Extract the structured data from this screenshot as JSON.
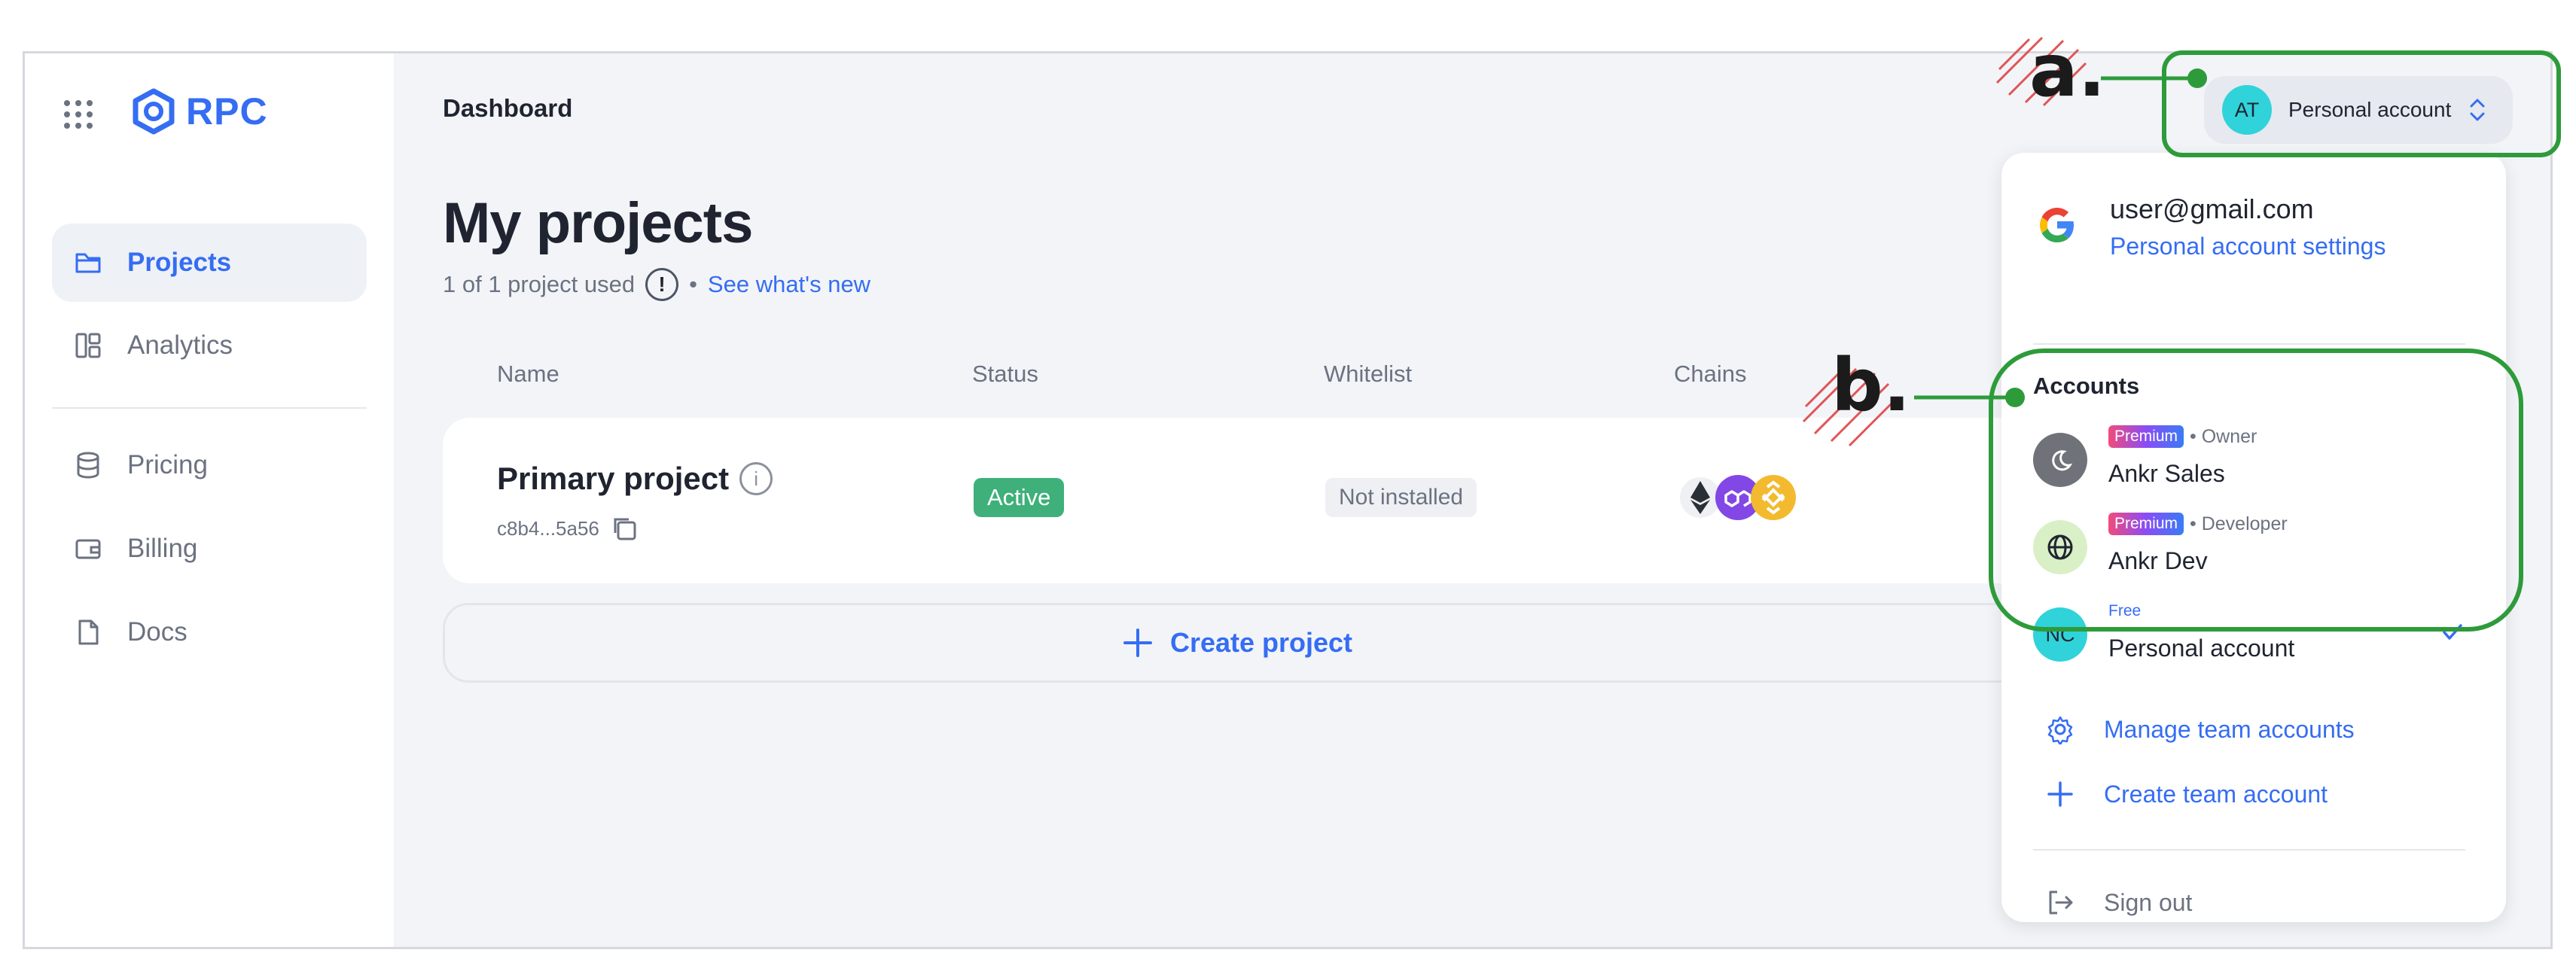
{
  "sidebar": {
    "logo_text": "RPC",
    "items": [
      {
        "label": "Projects"
      },
      {
        "label": "Analytics"
      },
      {
        "label": "Pricing"
      },
      {
        "label": "Billing"
      },
      {
        "label": "Docs"
      }
    ]
  },
  "header": {
    "breadcrumb": "Dashboard",
    "account_pill": {
      "initials": "AT",
      "label": "Personal account"
    }
  },
  "main": {
    "title": "My projects",
    "usage": "1 of 1 project used",
    "info_mark": "!",
    "separator": "•",
    "whats_new": "See what's new",
    "columns": [
      "Name",
      "Status",
      "Whitelist",
      "Chains"
    ],
    "project": {
      "name": "Primary project",
      "info_mark": "i",
      "id": "c8b4...5a56",
      "status": "Active",
      "whitelist": "Not installed",
      "chains": [
        "ethereum-icon",
        "polygon-icon",
        "bnb-icon"
      ]
    },
    "create_label": "Create project"
  },
  "dropdown": {
    "email": "user@gmail.com",
    "settings_link": "Personal account settings",
    "accounts_heading": "Accounts",
    "accounts": [
      {
        "tag": "Premium",
        "role": "• Owner",
        "name": "Ankr Sales",
        "avatar": "moon-icon"
      },
      {
        "tag": "Premium",
        "role": "• Developer",
        "name": "Ankr Dev",
        "avatar": "globe-icon"
      },
      {
        "tag": "Free",
        "role": "",
        "name": "Personal account",
        "initials": "NC",
        "selected": true
      }
    ],
    "manage_team": "Manage team accounts",
    "create_team": "Create team account",
    "sign_out": "Sign out"
  },
  "annotations": {
    "a": "a.",
    "b": "b."
  },
  "colors": {
    "accent": "#356df3",
    "active_green": "#3fb07a",
    "annotation_green": "#2e9b3b",
    "avatar_cyan": "#2fd3d9",
    "hatch_red": "#e05555"
  }
}
